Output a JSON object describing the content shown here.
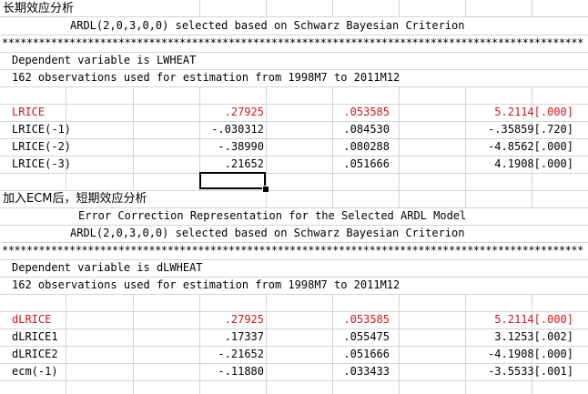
{
  "colors": {
    "highlight": "#d4141b",
    "grid": "#d4d4d4"
  },
  "section1": {
    "heading": "长期效应分析",
    "subtitle": "ARDL(2,0,3,0,0) selected based on Schwarz Bayesian Criterion",
    "stars": "***************************************************************************************************",
    "dep_var": "Dependent variable is LWHEAT",
    "obs": "162 observations used for estimation from 1998M7  to 2011M12",
    "rows": [
      {
        "name": "LRICE",
        "coef": ".27925",
        "se": ".053585",
        "t": "5.2114[.000]"
      },
      {
        "name": "LRICE(-1)",
        "coef": "-.030312",
        "se": ".084530",
        "t": "-.35859[.720]"
      },
      {
        "name": "LRICE(-2)",
        "coef": "-.38990",
        "se": ".080288",
        "t": "-4.8562[.000]"
      },
      {
        "name": "LRICE(-3)",
        "coef": ".21652",
        "se": ".051666",
        "t": "4.1908[.000]"
      }
    ]
  },
  "section2": {
    "heading": "加入ECM后，短期效应分析",
    "subtitle1": "Error Correction Representation for the Selected ARDL Model",
    "subtitle2": "ARDL(2,0,3,0,0) selected based on Schwarz Bayesian Criterion",
    "stars": "***************************************************************************************************",
    "dep_var": "Dependent variable is dLWHEAT",
    "obs": "162 observations used for estimation from 1998M7  to 2011M12",
    "rows": [
      {
        "name": "dLRICE",
        "coef": ".27925",
        "se": ".053585",
        "t": "5.2114[.000]"
      },
      {
        "name": "dLRICE1",
        "coef": ".17337",
        "se": ".055475",
        "t": "3.1253[.002]"
      },
      {
        "name": "dLRICE2",
        "coef": "-.21652",
        "se": ".051666",
        "t": "-4.1908[.000]"
      },
      {
        "name": "ecm(-1)",
        "coef": "-.11880",
        "se": ".033433",
        "t": "-3.5533[.001]"
      }
    ]
  }
}
